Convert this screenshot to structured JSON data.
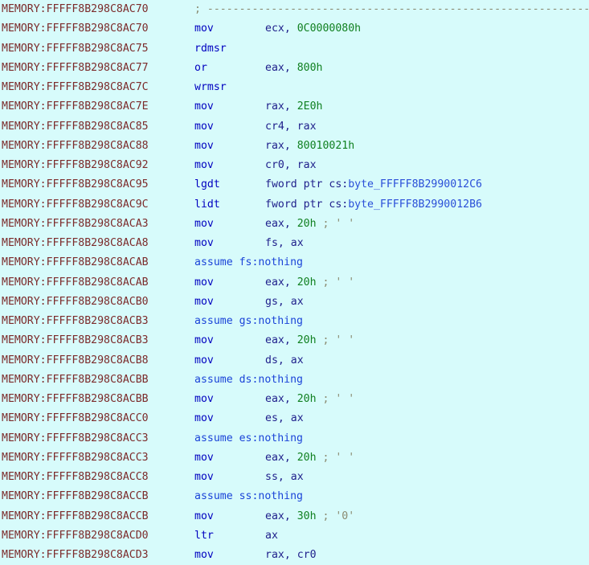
{
  "view": {
    "name": "ida-disassembly-view",
    "segment_prefix": "MEMORY:",
    "background_color": "#d7fbfb",
    "address_color": "#7c2b2b",
    "mnemonic_color": "#0000c0",
    "register_color": "#20208c",
    "immediate_color": "#108020",
    "symbol_color": "#2a4fd8",
    "comment_color": "#8a8a70",
    "dashed_separator": "; ------------------------------------------------------------------------------------------"
  },
  "lines": [
    {
      "address": "MEMORY:FFFFF8B298C8AC70",
      "kind": "comment",
      "comment": "; -----------------------------------------------------------------------------------------"
    },
    {
      "address": "MEMORY:FFFFF8B298C8AC70",
      "kind": "instruction",
      "mnemonic": "mov",
      "operands": [
        {
          "text": "ecx",
          "type": "register"
        },
        {
          "text": ", ",
          "type": "punct"
        },
        {
          "text": "0C0000080h",
          "type": "immediate"
        }
      ]
    },
    {
      "address": "MEMORY:FFFFF8B298C8AC75",
      "kind": "instruction",
      "mnemonic": "rdmsr",
      "operands": []
    },
    {
      "address": "MEMORY:FFFFF8B298C8AC77",
      "kind": "instruction",
      "mnemonic": "or",
      "operands": [
        {
          "text": "eax",
          "type": "register"
        },
        {
          "text": ", ",
          "type": "punct"
        },
        {
          "text": "800h",
          "type": "immediate"
        }
      ]
    },
    {
      "address": "MEMORY:FFFFF8B298C8AC7C",
      "kind": "instruction",
      "mnemonic": "wrmsr",
      "operands": []
    },
    {
      "address": "MEMORY:FFFFF8B298C8AC7E",
      "kind": "instruction",
      "mnemonic": "mov",
      "operands": [
        {
          "text": "rax",
          "type": "register"
        },
        {
          "text": ", ",
          "type": "punct"
        },
        {
          "text": "2E0h",
          "type": "immediate"
        }
      ]
    },
    {
      "address": "MEMORY:FFFFF8B298C8AC85",
      "kind": "instruction",
      "mnemonic": "mov",
      "operands": [
        {
          "text": "cr4",
          "type": "register"
        },
        {
          "text": ", ",
          "type": "punct"
        },
        {
          "text": "rax",
          "type": "register"
        }
      ]
    },
    {
      "address": "MEMORY:FFFFF8B298C8AC88",
      "kind": "instruction",
      "mnemonic": "mov",
      "operands": [
        {
          "text": "rax",
          "type": "register"
        },
        {
          "text": ", ",
          "type": "punct"
        },
        {
          "text": "80010021h",
          "type": "immediate"
        }
      ]
    },
    {
      "address": "MEMORY:FFFFF8B298C8AC92",
      "kind": "instruction",
      "mnemonic": "mov",
      "operands": [
        {
          "text": "cr0",
          "type": "register"
        },
        {
          "text": ", ",
          "type": "punct"
        },
        {
          "text": "rax",
          "type": "register"
        }
      ]
    },
    {
      "address": "MEMORY:FFFFF8B298C8AC95",
      "kind": "instruction",
      "mnemonic": "lgdt",
      "operands": [
        {
          "text": "fword ptr cs:",
          "type": "keyword"
        },
        {
          "text": "byte_FFFFF8B2990012C6",
          "type": "symbol"
        }
      ]
    },
    {
      "address": "MEMORY:FFFFF8B298C8AC9C",
      "kind": "instruction",
      "mnemonic": "lidt",
      "operands": [
        {
          "text": "fword ptr cs:",
          "type": "keyword"
        },
        {
          "text": "byte_FFFFF8B2990012B6",
          "type": "symbol"
        }
      ]
    },
    {
      "address": "MEMORY:FFFFF8B298C8ACA3",
      "kind": "instruction",
      "mnemonic": "mov",
      "operands": [
        {
          "text": "eax",
          "type": "register"
        },
        {
          "text": ", ",
          "type": "punct"
        },
        {
          "text": "20h",
          "type": "immediate"
        },
        {
          "text": " ; ' '",
          "type": "comment"
        }
      ]
    },
    {
      "address": "MEMORY:FFFFF8B298C8ACA8",
      "kind": "instruction",
      "mnemonic": "mov",
      "operands": [
        {
          "text": "fs",
          "type": "register"
        },
        {
          "text": ", ",
          "type": "punct"
        },
        {
          "text": "ax",
          "type": "register"
        }
      ]
    },
    {
      "address": "MEMORY:FFFFF8B298C8ACAB",
      "kind": "assume",
      "text": "assume fs:nothing"
    },
    {
      "address": "MEMORY:FFFFF8B298C8ACAB",
      "kind": "instruction",
      "mnemonic": "mov",
      "operands": [
        {
          "text": "eax",
          "type": "register"
        },
        {
          "text": ", ",
          "type": "punct"
        },
        {
          "text": "20h",
          "type": "immediate"
        },
        {
          "text": " ; ' '",
          "type": "comment"
        }
      ]
    },
    {
      "address": "MEMORY:FFFFF8B298C8ACB0",
      "kind": "instruction",
      "mnemonic": "mov",
      "operands": [
        {
          "text": "gs",
          "type": "register"
        },
        {
          "text": ", ",
          "type": "punct"
        },
        {
          "text": "ax",
          "type": "register"
        }
      ]
    },
    {
      "address": "MEMORY:FFFFF8B298C8ACB3",
      "kind": "assume",
      "text": "assume gs:nothing"
    },
    {
      "address": "MEMORY:FFFFF8B298C8ACB3",
      "kind": "instruction",
      "mnemonic": "mov",
      "operands": [
        {
          "text": "eax",
          "type": "register"
        },
        {
          "text": ", ",
          "type": "punct"
        },
        {
          "text": "20h",
          "type": "immediate"
        },
        {
          "text": " ; ' '",
          "type": "comment"
        }
      ]
    },
    {
      "address": "MEMORY:FFFFF8B298C8ACB8",
      "kind": "instruction",
      "mnemonic": "mov",
      "operands": [
        {
          "text": "ds",
          "type": "register"
        },
        {
          "text": ", ",
          "type": "punct"
        },
        {
          "text": "ax",
          "type": "register"
        }
      ]
    },
    {
      "address": "MEMORY:FFFFF8B298C8ACBB",
      "kind": "assume",
      "text": "assume ds:nothing"
    },
    {
      "address": "MEMORY:FFFFF8B298C8ACBB",
      "kind": "instruction",
      "mnemonic": "mov",
      "operands": [
        {
          "text": "eax",
          "type": "register"
        },
        {
          "text": ", ",
          "type": "punct"
        },
        {
          "text": "20h",
          "type": "immediate"
        },
        {
          "text": " ; ' '",
          "type": "comment"
        }
      ]
    },
    {
      "address": "MEMORY:FFFFF8B298C8ACC0",
      "kind": "instruction",
      "mnemonic": "mov",
      "operands": [
        {
          "text": "es",
          "type": "register"
        },
        {
          "text": ", ",
          "type": "punct"
        },
        {
          "text": "ax",
          "type": "register"
        }
      ]
    },
    {
      "address": "MEMORY:FFFFF8B298C8ACC3",
      "kind": "assume",
      "text": "assume es:nothing"
    },
    {
      "address": "MEMORY:FFFFF8B298C8ACC3",
      "kind": "instruction",
      "mnemonic": "mov",
      "operands": [
        {
          "text": "eax",
          "type": "register"
        },
        {
          "text": ", ",
          "type": "punct"
        },
        {
          "text": "20h",
          "type": "immediate"
        },
        {
          "text": " ; ' '",
          "type": "comment"
        }
      ]
    },
    {
      "address": "MEMORY:FFFFF8B298C8ACC8",
      "kind": "instruction",
      "mnemonic": "mov",
      "operands": [
        {
          "text": "ss",
          "type": "register"
        },
        {
          "text": ", ",
          "type": "punct"
        },
        {
          "text": "ax",
          "type": "register"
        }
      ]
    },
    {
      "address": "MEMORY:FFFFF8B298C8ACCB",
      "kind": "assume",
      "text": "assume ss:nothing"
    },
    {
      "address": "MEMORY:FFFFF8B298C8ACCB",
      "kind": "instruction",
      "mnemonic": "mov",
      "operands": [
        {
          "text": "eax",
          "type": "register"
        },
        {
          "text": ", ",
          "type": "punct"
        },
        {
          "text": "30h",
          "type": "immediate"
        },
        {
          "text": " ; '0'",
          "type": "comment"
        }
      ]
    },
    {
      "address": "MEMORY:FFFFF8B298C8ACD0",
      "kind": "instruction",
      "mnemonic": "ltr",
      "operands": [
        {
          "text": "ax",
          "type": "register"
        }
      ]
    },
    {
      "address": "MEMORY:FFFFF8B298C8ACD3",
      "kind": "instruction",
      "mnemonic": "mov",
      "operands": [
        {
          "text": "rax",
          "type": "register"
        },
        {
          "text": ", ",
          "type": "punct"
        },
        {
          "text": "cr0",
          "type": "register"
        }
      ]
    }
  ]
}
